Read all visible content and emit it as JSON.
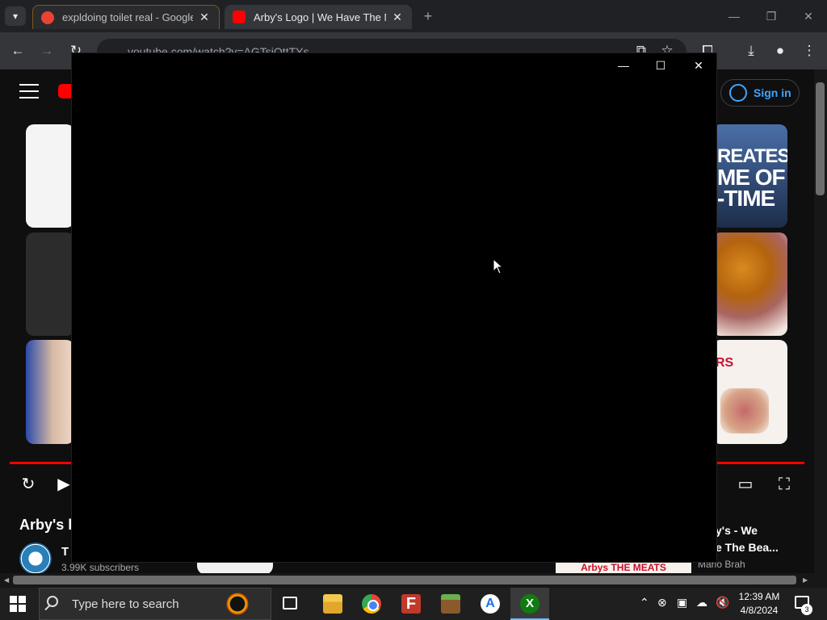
{
  "browser": {
    "tabs": [
      {
        "title": "expldoing toilet real - Google S",
        "favicon_color": "#ea4335"
      },
      {
        "title": "Arby's Logo | We Have The Mea",
        "favicon_color": "#ff0000"
      }
    ],
    "address": "youtube.com/watch?v=AGTsjOttTYs"
  },
  "youtube": {
    "signin_label": "Sign in",
    "thumb_r1_line1": "REATEST",
    "thumb_r1_line2": "ME OF",
    "thumb_r1_line3": "-TIME",
    "thumb_r3_text": "RS",
    "video_title": "Arby's l",
    "channel_name": "T",
    "subscribers": "3.99K subscribers",
    "related_title_line1": "y's - We",
    "related_title_line2": "e The Bea...",
    "related_channel": "Mario Brah",
    "ad_text": "Arbys THE MEATS"
  },
  "taskbar": {
    "search_placeholder": "Type here to search",
    "time": "12:39 AM",
    "date": "4/8/2024",
    "notification_count": "3"
  }
}
